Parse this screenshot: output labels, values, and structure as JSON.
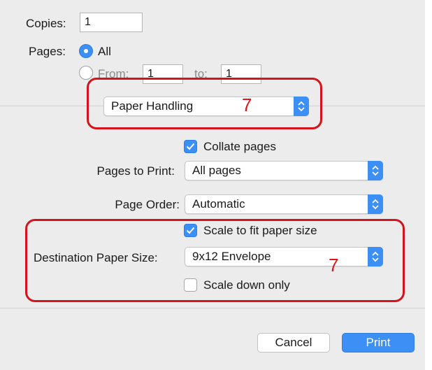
{
  "copies": {
    "label": "Copies:",
    "value": "1"
  },
  "pages": {
    "label": "Pages:",
    "all_label": "All",
    "from_label": "From:",
    "from_value": "1",
    "to_label": "to:",
    "to_value": "1",
    "selected": "All"
  },
  "section_menu": {
    "value": "Paper Handling"
  },
  "collate": {
    "label": "Collate pages",
    "checked": true
  },
  "pages_to_print": {
    "label": "Pages to Print:",
    "value": "All pages"
  },
  "page_order": {
    "label": "Page Order:",
    "value": "Automatic"
  },
  "scale_to_fit": {
    "label": "Scale to fit paper size",
    "checked": true
  },
  "destination_paper_size": {
    "label": "Destination Paper Size:",
    "value": "9x12 Envelope"
  },
  "scale_down_only": {
    "label": "Scale down only",
    "checked": false
  },
  "annotations": {
    "top_number": "7",
    "bottom_number": "7",
    "color": "#d4141c"
  },
  "buttons": {
    "cancel": "Cancel",
    "print": "Print"
  },
  "colors": {
    "accent": "#3b8ff5",
    "panel": "#ececec"
  }
}
